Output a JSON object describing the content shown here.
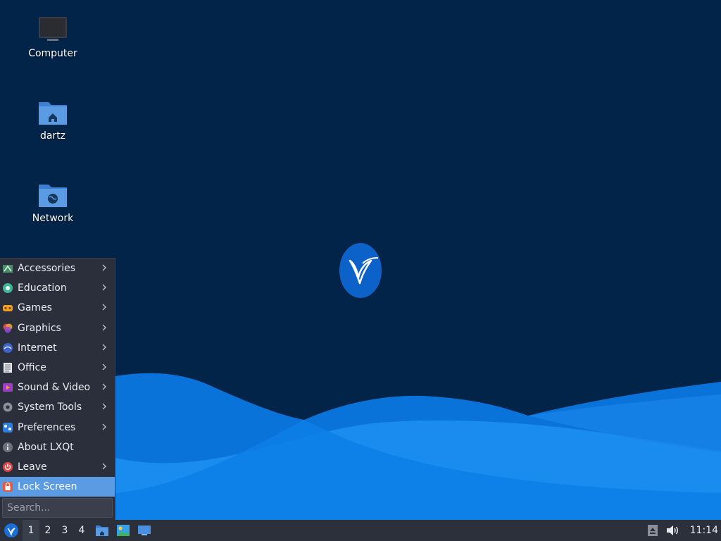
{
  "desktop": {
    "icons": [
      {
        "name": "computer",
        "label": "Computer"
      },
      {
        "name": "home",
        "label": "dartz"
      },
      {
        "name": "network",
        "label": "Network"
      }
    ],
    "background_color": "#012448",
    "logo_icon": "lxqt-hummingbird-icon"
  },
  "start_menu": {
    "items": [
      {
        "label": "Accessories",
        "icon": "accessories-icon",
        "submenu": true
      },
      {
        "label": "Education",
        "icon": "education-icon",
        "submenu": true
      },
      {
        "label": "Games",
        "icon": "games-icon",
        "submenu": true
      },
      {
        "label": "Graphics",
        "icon": "graphics-icon",
        "submenu": true
      },
      {
        "label": "Internet",
        "icon": "internet-icon",
        "submenu": true
      },
      {
        "label": "Office",
        "icon": "office-icon",
        "submenu": true
      },
      {
        "label": "Sound & Video",
        "icon": "sound-video-icon",
        "submenu": true
      },
      {
        "label": "System Tools",
        "icon": "system-tools-icon",
        "submenu": true
      },
      {
        "label": "Preferences",
        "icon": "preferences-icon",
        "submenu": true
      },
      {
        "label": "About LXQt",
        "icon": "about-icon",
        "submenu": false
      },
      {
        "label": "Leave",
        "icon": "leave-icon",
        "submenu": true
      },
      {
        "label": "Lock Screen",
        "icon": "lock-icon",
        "submenu": false,
        "active": true
      }
    ],
    "search_placeholder": "Search...",
    "highlight_color": "#5a9be3"
  },
  "taskbar": {
    "workspaces": [
      "1",
      "2",
      "3",
      "4"
    ],
    "active_workspace": "1",
    "launchers": [
      "file-manager-icon",
      "image-viewer-icon",
      "show-desktop-icon"
    ],
    "tray": [
      "eject-icon",
      "volume-icon"
    ],
    "clock": "11:14"
  }
}
